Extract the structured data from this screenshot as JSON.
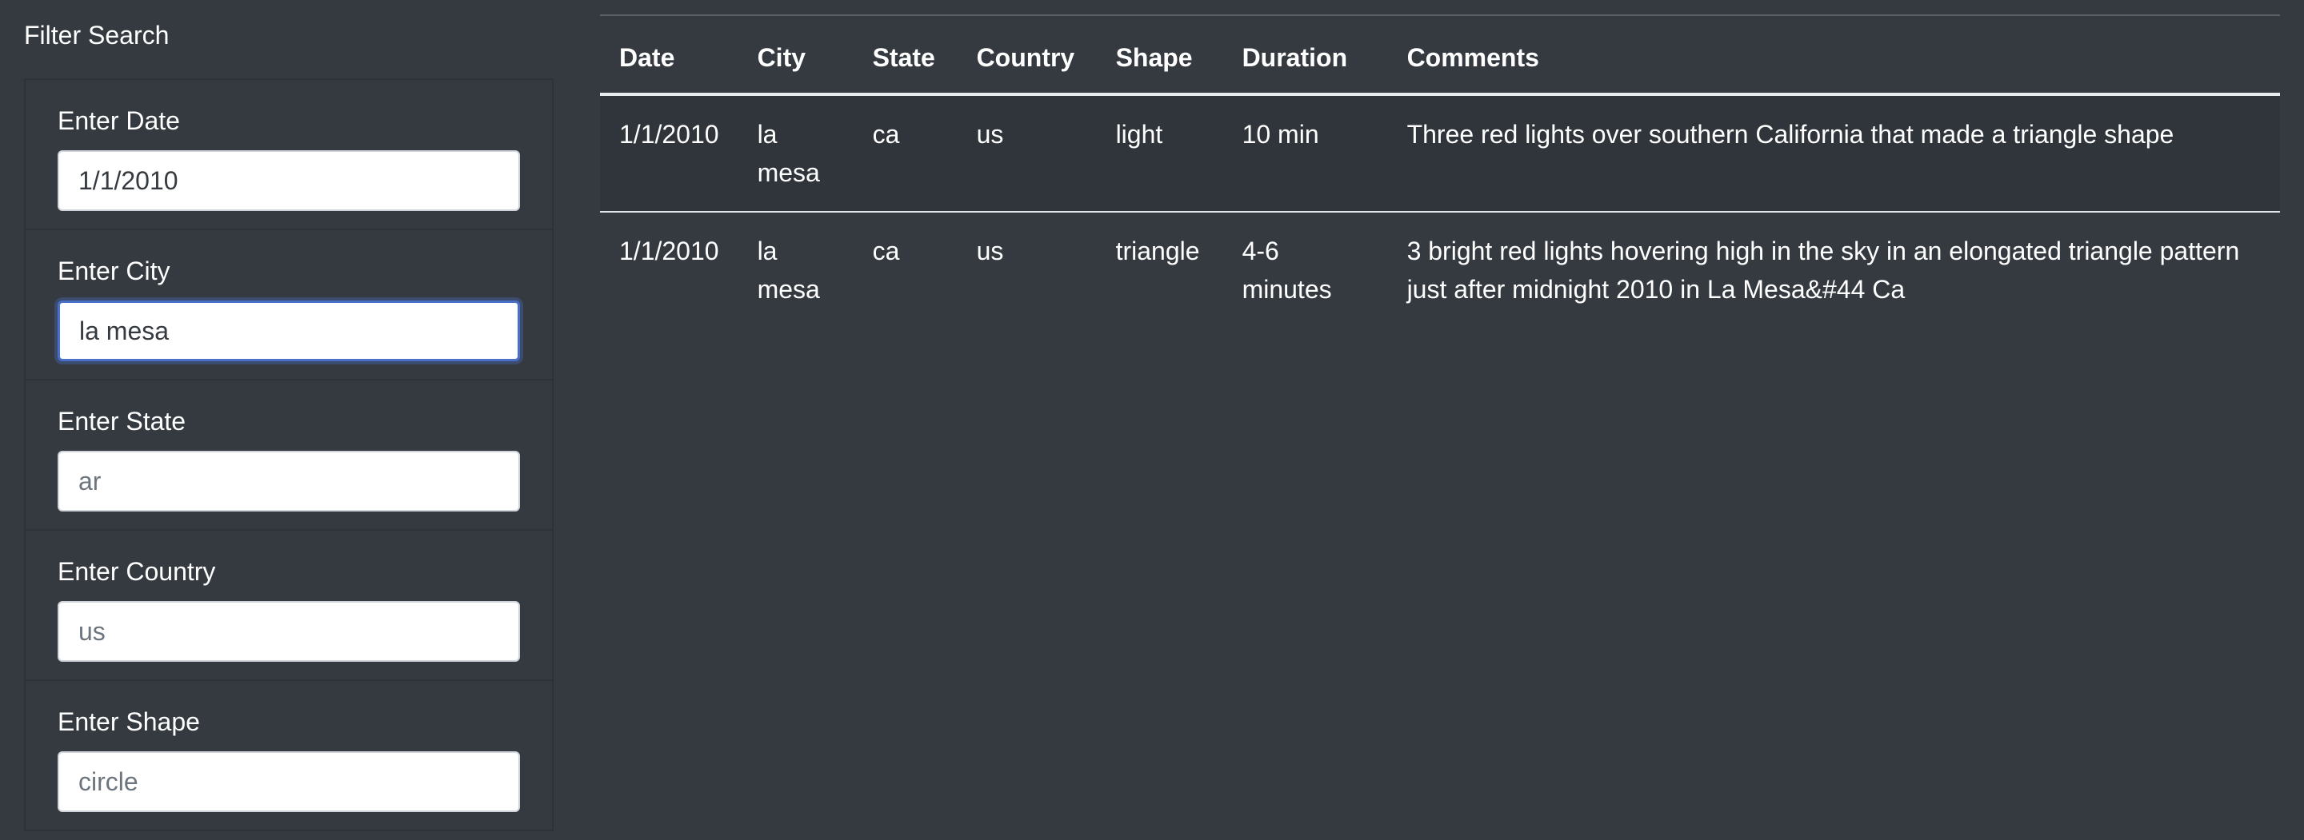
{
  "filter": {
    "title": "Filter Search",
    "fields": [
      {
        "label": "Enter Date",
        "value": "1/1/2010",
        "placeholder": "1/1/2010"
      },
      {
        "label": "Enter City",
        "value": "la mesa",
        "placeholder": ""
      },
      {
        "label": "Enter State",
        "value": "",
        "placeholder": "ar"
      },
      {
        "label": "Enter Country",
        "value": "",
        "placeholder": "us"
      },
      {
        "label": "Enter Shape",
        "value": "",
        "placeholder": "circle"
      }
    ]
  },
  "table": {
    "headers": [
      "Date",
      "City",
      "State",
      "Country",
      "Shape",
      "Duration",
      "Comments"
    ],
    "rows": [
      [
        "1/1/2010",
        "la mesa",
        "ca",
        "us",
        "light",
        "10 min",
        "Three red lights over southern California that made a triangle shape"
      ],
      [
        "1/1/2010",
        "la mesa",
        "ca",
        "us",
        "triangle",
        "4-6 minutes",
        "3 bright red lights hovering high in the sky in an elongated triangle pattern just after midnight 2010 in La Mesa&#44 Ca"
      ]
    ]
  },
  "colors": {
    "background": "#343a40",
    "focus_ring": "#4a6fc9",
    "text": "#ffffff"
  }
}
